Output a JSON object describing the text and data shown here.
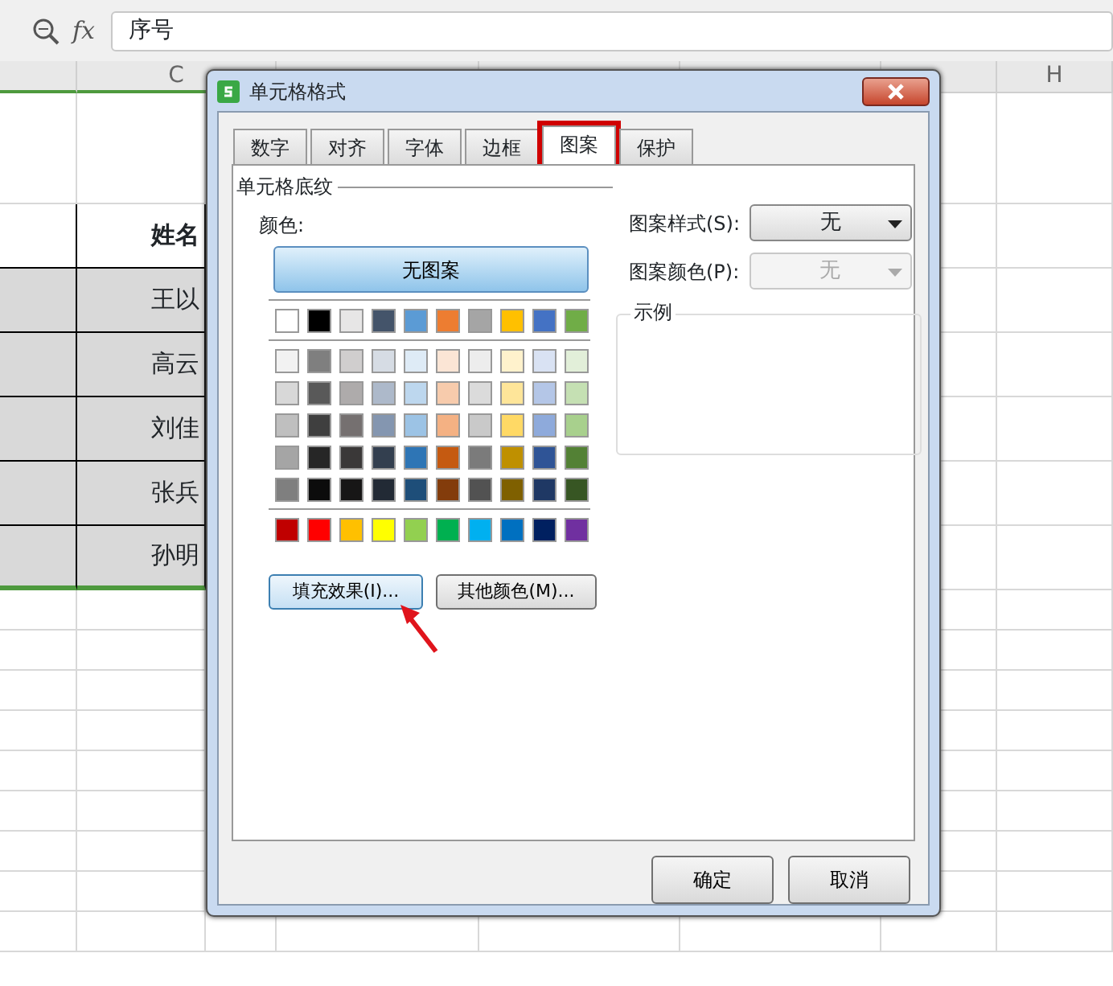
{
  "formula_bar": {
    "function_label": "fx",
    "value": "序号"
  },
  "column_headers": [
    {
      "label": "C"
    },
    {
      "label": "H"
    }
  ],
  "table": {
    "header": "姓名",
    "rows": [
      "王以",
      "高云",
      "刘佳",
      "张兵",
      "孙明"
    ]
  },
  "dialog": {
    "title": "单元格格式",
    "tabs": [
      {
        "label": "数字",
        "selected": false,
        "highlighted": false
      },
      {
        "label": "对齐",
        "selected": false,
        "highlighted": false
      },
      {
        "label": "字体",
        "selected": false,
        "highlighted": false
      },
      {
        "label": "边框",
        "selected": false,
        "highlighted": false
      },
      {
        "label": "图案",
        "selected": true,
        "highlighted": true
      },
      {
        "label": "保护",
        "selected": false,
        "highlighted": false
      }
    ],
    "group_title": "单元格底纹",
    "color_label": "颜色:",
    "no_pattern_button": "无图案",
    "theme_colors": [
      {
        "color": "#ffffff"
      },
      {
        "color": "#000000"
      },
      {
        "color": "#e7e6e6"
      },
      {
        "color": "#44546a"
      },
      {
        "color": "#5b9bd5"
      },
      {
        "color": "#ed7d31"
      },
      {
        "color": "#a5a5a5"
      },
      {
        "color": "#ffc000"
      },
      {
        "color": "#4472c4"
      },
      {
        "color": "#70ad47"
      }
    ],
    "shade_rows": [
      [
        {
          "color": "#f2f2f2"
        },
        {
          "color": "#7f7f7f"
        },
        {
          "color": "#d0cece"
        },
        {
          "color": "#d6dce4"
        },
        {
          "color": "#deebf6"
        },
        {
          "color": "#fbe5d5"
        },
        {
          "color": "#ededed"
        },
        {
          "color": "#fff2cc"
        },
        {
          "color": "#d9e2f3"
        },
        {
          "color": "#e2efd9"
        }
      ],
      [
        {
          "color": "#d8d8d8"
        },
        {
          "color": "#595959"
        },
        {
          "color": "#aeabab"
        },
        {
          "color": "#adb9ca"
        },
        {
          "color": "#bdd7ee"
        },
        {
          "color": "#f7cbac"
        },
        {
          "color": "#dbdbdb"
        },
        {
          "color": "#fee599"
        },
        {
          "color": "#b4c6e7"
        },
        {
          "color": "#c5e0b3"
        }
      ],
      [
        {
          "color": "#bfbfbf"
        },
        {
          "color": "#3f3f3f"
        },
        {
          "color": "#757070"
        },
        {
          "color": "#8496b0"
        },
        {
          "color": "#9cc3e5"
        },
        {
          "color": "#f4b183"
        },
        {
          "color": "#c9c9c9"
        },
        {
          "color": "#ffd965"
        },
        {
          "color": "#8eaadb"
        },
        {
          "color": "#a8d08d"
        }
      ],
      [
        {
          "color": "#a5a5a5"
        },
        {
          "color": "#262626"
        },
        {
          "color": "#3a3838"
        },
        {
          "color": "#333f4f"
        },
        {
          "color": "#2e75b5"
        },
        {
          "color": "#c55a11"
        },
        {
          "color": "#7b7b7b"
        },
        {
          "color": "#bf9000"
        },
        {
          "color": "#2f5496"
        },
        {
          "color": "#538135"
        }
      ],
      [
        {
          "color": "#7f7f7f"
        },
        {
          "color": "#0c0c0c"
        },
        {
          "color": "#171616"
        },
        {
          "color": "#222a35"
        },
        {
          "color": "#1e4e79"
        },
        {
          "color": "#833c0b"
        },
        {
          "color": "#525252"
        },
        {
          "color": "#7f6000"
        },
        {
          "color": "#1f3864"
        },
        {
          "color": "#375623"
        }
      ]
    ],
    "standard_colors": [
      {
        "color": "#c00000"
      },
      {
        "color": "#ff0000"
      },
      {
        "color": "#ffc000"
      },
      {
        "color": "#ffff00"
      },
      {
        "color": "#92d050"
      },
      {
        "color": "#00b050"
      },
      {
        "color": "#00b0f0"
      },
      {
        "color": "#0070c0"
      },
      {
        "color": "#002060"
      },
      {
        "color": "#7030a0"
      }
    ],
    "fill_effects_button": "填充效果(I)...",
    "more_colors_button": "其他颜色(M)...",
    "pattern_style": {
      "label": "图案样式(S):",
      "value": "无",
      "disabled": false
    },
    "pattern_color": {
      "label": "图案颜色(P):",
      "value": "无",
      "disabled": true
    },
    "preview_label": "示例",
    "buttons": [
      "确定",
      "取消"
    ]
  }
}
